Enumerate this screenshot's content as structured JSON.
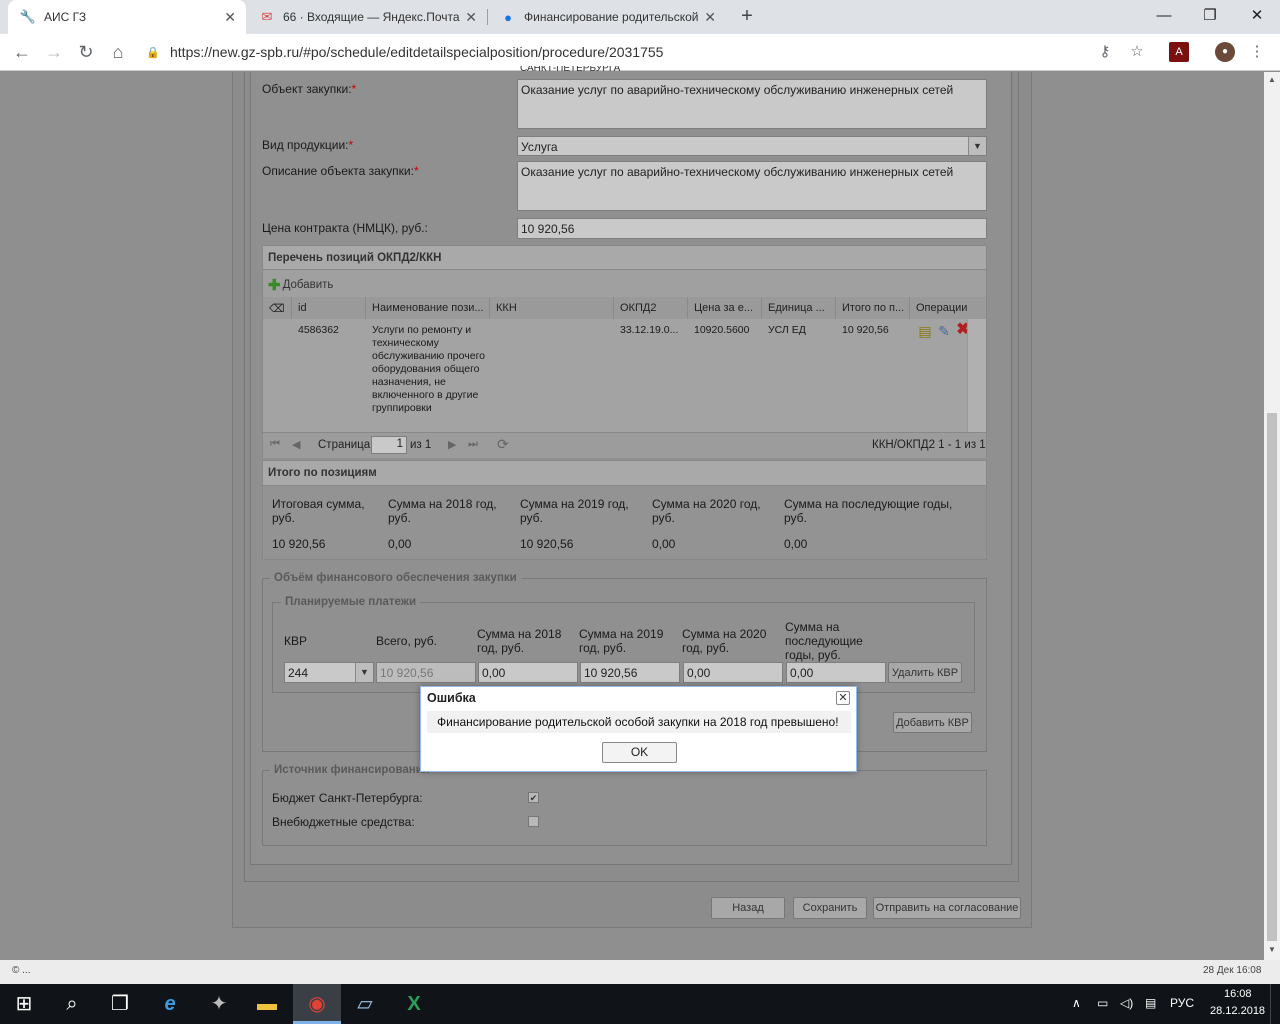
{
  "browser": {
    "tabs": [
      {
        "title": "АИС ГЗ",
        "icon": "wrench-icon"
      },
      {
        "title": "66 · Входящие — Яндекс.Почта",
        "icon": "mail-icon"
      },
      {
        "title": "Финансирование родительской",
        "icon": "globe-icon"
      }
    ],
    "url": "https://new.gz-spb.ru/#po/schedule/editdetailspecialposition/procedure/2031755"
  },
  "form": {
    "top_cut_text": "САНКТ-ПЕТЕРБУРГА",
    "object_label": "Объект закупки:",
    "object_value": "Оказание услуг по аварийно-техническому обслуживанию инженерных сетей",
    "product_type_label": "Вид продукции:",
    "product_type_value": "Услуга",
    "description_label": "Описание объекта закупки:",
    "description_value": "Оказание услуг по аварийно-техническому обслуживанию инженерных сетей",
    "price_label": "Цена контракта (НМЦК), руб.:",
    "price_value": "10 920,56",
    "required_mark": "*"
  },
  "okpd": {
    "title": "Перечень позиций ОКПД2/ККН",
    "add_label": "Добавить",
    "columns": [
      "id",
      "Наименование пози...",
      "ККН",
      "ОКПД2",
      "Цена за е...",
      "Единица ...",
      "Итого по п...",
      "Операции"
    ],
    "row": {
      "id": "4586362",
      "name": "Услуги по ремонту и техническому обслуживанию прочего оборудования общего назначения, не включенного в другие группировки",
      "kkn": "",
      "okpd2": "33.12.19.0...",
      "price": "10920.5600",
      "unit": "УСЛ ЕД",
      "total": "10 920,56"
    },
    "pager": {
      "page_label": "Страница",
      "page": "1",
      "of": "из 1",
      "summary": "ККН/ОКПД2 1 - 1 из 1"
    }
  },
  "totals": {
    "title": "Итого по позициям",
    "headers": [
      "Итоговая сумма, руб.",
      "Сумма на 2018 год, руб.",
      "Сумма на 2019 год, руб.",
      "Сумма на 2020 год, руб.",
      "Сумма на последующие годы, руб."
    ],
    "values": [
      "10 920,56",
      "0,00",
      "10 920,56",
      "0,00",
      "0,00"
    ]
  },
  "finance": {
    "legend": "Объём финансового обеспечения закупки",
    "planned_legend": "Планируемые платежи",
    "headers": [
      "КВР",
      "Всего, руб.",
      "Сумма на 2018 год, руб.",
      "Сумма на 2019 год, руб.",
      "Сумма на 2020 год, руб.",
      "Сумма на последующие годы, руб."
    ],
    "kvr": "244",
    "total": "10 920,56",
    "y2018": "0,00",
    "y2019": "10 920,56",
    "y2020": "0,00",
    "later": "0,00",
    "delete_btn": "Удалить КВР",
    "add_btn": "Добавить КВР"
  },
  "source": {
    "legend": "Источник финансирования",
    "budget_label": "Бюджет Санкт-Петербурга:",
    "budget_checked": true,
    "extra_label": "Внебюджетные средства:",
    "extra_checked": false
  },
  "actions": {
    "back": "Назад",
    "save": "Сохранить",
    "send": "Отправить на согласование"
  },
  "dialog": {
    "title": "Ошибка",
    "message": "Финансирование родительской особой закупки на 2018 год превышено!",
    "ok": "OK"
  },
  "status": {
    "left": "© ...",
    "right": "28 Дек 16:08"
  },
  "taskbar": {
    "lang": "РУС",
    "time": "16:08",
    "date": "28.12.2018"
  }
}
